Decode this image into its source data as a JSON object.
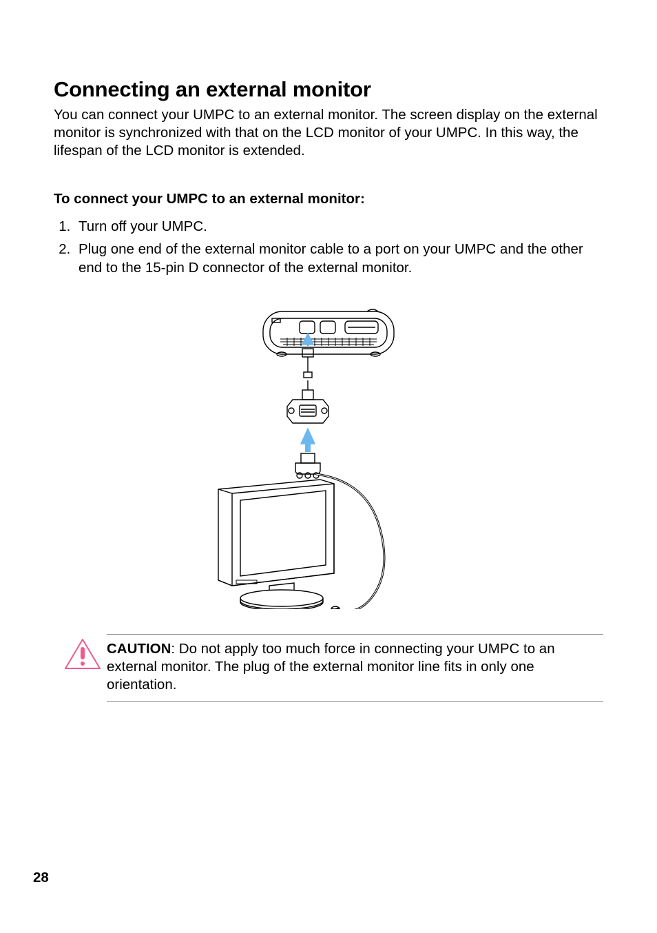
{
  "heading": "Connecting an external monitor",
  "intro": "You can connect your UMPC to an external monitor. The screen display on the external monitor is synchronized with that on the LCD monitor of your UMPC. In this way, the lifespan of the LCD monitor is extended.",
  "subhead": "To connect your UMPC to an external monitor:",
  "steps": [
    "Turn off your UMPC.",
    "Plug one end of the external monitor cable to a port on your UMPC and the other end to the 15-pin D connector of the external monitor."
  ],
  "caution_label": "CAUTION",
  "caution_text": ": Do not apply too much force in connecting your UMPC to an external monitor. The plug of the external monitor line fits in only one orientation.",
  "page_number": "28"
}
